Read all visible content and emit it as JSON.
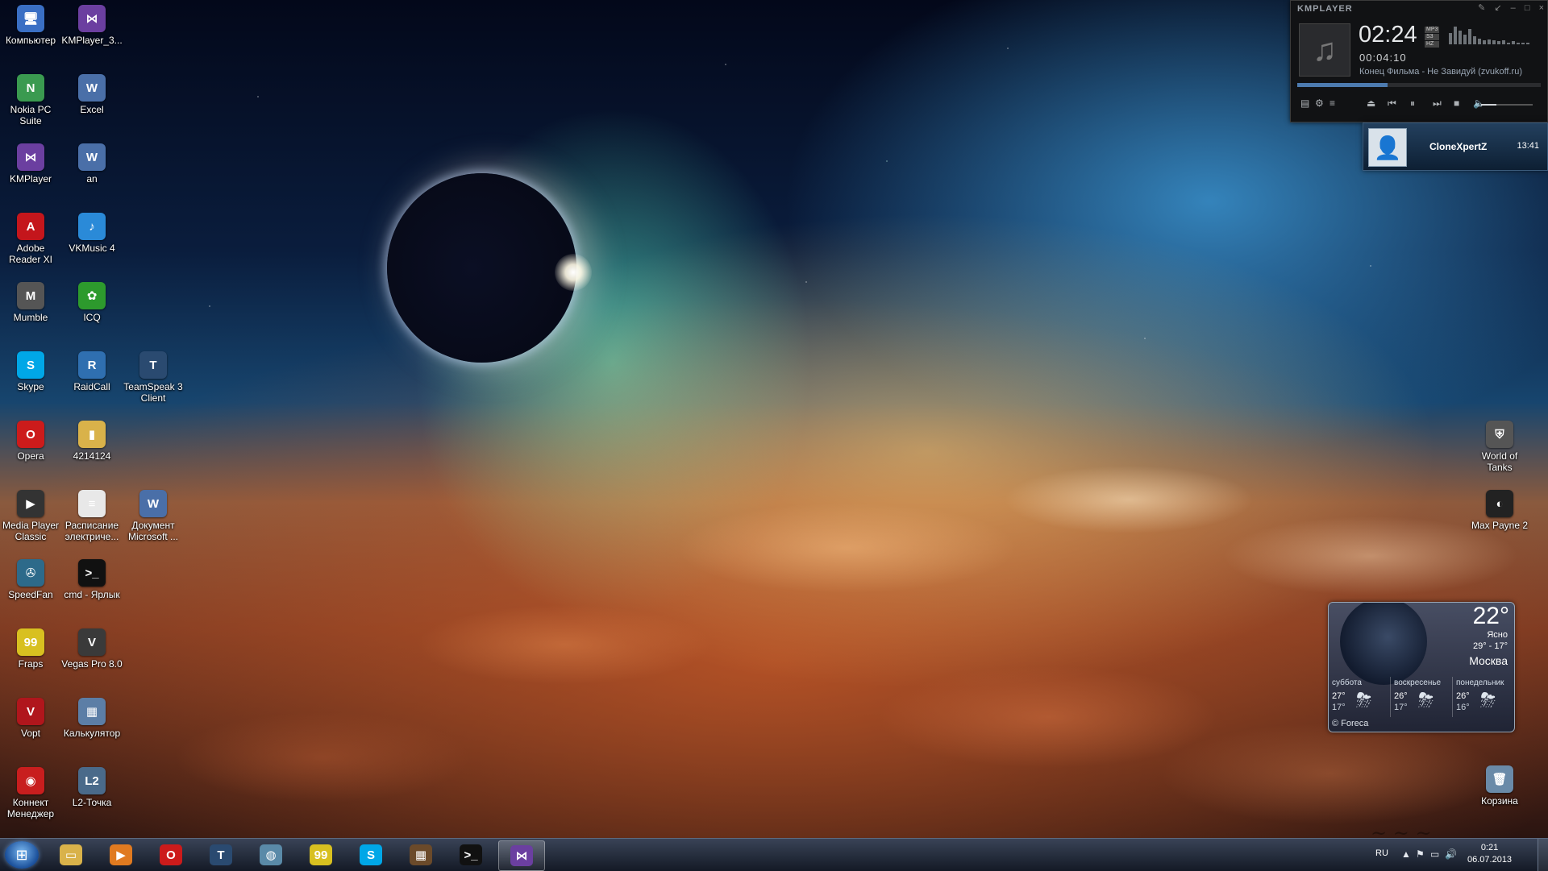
{
  "desktop": {
    "icons_left": [
      {
        "label": "Компьютер",
        "icon": "computer-icon",
        "glyph": "🖥",
        "color": "#3a6fc4"
      },
      {
        "label": "KMPlayer_3...",
        "icon": "kmplayer-icon",
        "glyph": "⋈",
        "color": "#6b3fa0"
      },
      {
        "label": "Nokia PC Suite",
        "icon": "nokia-icon",
        "glyph": "N",
        "color": "#3a9a50"
      },
      {
        "label": "Excel",
        "icon": "document-icon",
        "glyph": "W",
        "color": "#4a6fa8"
      },
      {
        "label": "KMPlayer",
        "icon": "kmplayer-icon",
        "glyph": "⋈",
        "color": "#6b3fa0"
      },
      {
        "label": "an",
        "icon": "document-icon",
        "glyph": "W",
        "color": "#4a6fa8"
      },
      {
        "label": "Adobe Reader XI",
        "icon": "adobe-reader-icon",
        "glyph": "A",
        "color": "#c4161c"
      },
      {
        "label": "VKMusic 4",
        "icon": "vkmusic-icon",
        "glyph": "♪",
        "color": "#2a8ad8"
      },
      {
        "label": "Mumble",
        "icon": "mumble-icon",
        "glyph": "M",
        "color": "#555"
      },
      {
        "label": "ICQ",
        "icon": "icq-icon",
        "glyph": "✿",
        "color": "#2d9a2d"
      },
      {
        "label": "Skype",
        "icon": "skype-icon",
        "glyph": "S",
        "color": "#00a7e7"
      },
      {
        "label": "RaidCall",
        "icon": "raidcall-icon",
        "glyph": "R",
        "color": "#2f6fb0"
      },
      {
        "label": "TeamSpeak 3 Client",
        "icon": "teamspeak-icon",
        "glyph": "T",
        "color": "#2a4a70"
      },
      {
        "label": "Opera",
        "icon": "opera-icon",
        "glyph": "O",
        "color": "#cc1b1b"
      },
      {
        "label": "4214124",
        "icon": "folder-icon",
        "glyph": "▮",
        "color": "#d9b24a"
      },
      {
        "label": "Media Player Classic",
        "icon": "mpc-icon",
        "glyph": "▶",
        "color": "#333"
      },
      {
        "label": "Расписание электриче...",
        "icon": "text-file-icon",
        "glyph": "≡",
        "color": "#e8e8e8"
      },
      {
        "label": "Документ Microsoft ...",
        "icon": "document-icon",
        "glyph": "W",
        "color": "#4a6fa8"
      },
      {
        "label": "SpeedFan",
        "icon": "speedfan-icon",
        "glyph": "✇",
        "color": "#2d6a8a"
      },
      {
        "label": "cmd - Ярлык",
        "icon": "cmd-icon",
        "glyph": ">_",
        "color": "#111"
      },
      {
        "label": "Fraps",
        "icon": "fraps-icon",
        "glyph": "99",
        "color": "#d8c020"
      },
      {
        "label": "Vegas Pro 8.0",
        "icon": "vegas-icon",
        "glyph": "V",
        "color": "#3a3a3a"
      },
      {
        "label": "Vopt",
        "icon": "vopt-icon",
        "glyph": "V",
        "color": "#b0161c"
      },
      {
        "label": "Калькулятор",
        "icon": "calculator-icon",
        "glyph": "▦",
        "color": "#5c7ea6"
      },
      {
        "label": "Коннект Менеджер",
        "icon": "connect-manager-icon",
        "glyph": "◉",
        "color": "#c81e1e"
      },
      {
        "label": "L2-Точка",
        "icon": "l2-icon",
        "glyph": "L2",
        "color": "#4a6a8a"
      }
    ],
    "icons_right": [
      {
        "label": "World of Tanks",
        "icon": "world-of-tanks-icon",
        "glyph": "⛨",
        "color": "#555"
      },
      {
        "label": "Max Payne 2",
        "icon": "max-payne-icon",
        "glyph": "◐",
        "color": "#222"
      },
      {
        "label": "Корзина",
        "icon": "recycle-bin-icon",
        "glyph": "🗑",
        "color": "#6a8aa8"
      }
    ]
  },
  "kmplayer": {
    "brand": "KMPLAYER",
    "time": "02:24",
    "elapsed": "00:04:10",
    "track": "Конец Фильма - Не Завидуй (zvukoff.ru)",
    "progress": 0.37,
    "volume": 0.3,
    "badges": [
      "MP3",
      "S3",
      "HZ"
    ],
    "eq_levels": [
      0.6,
      0.9,
      0.7,
      0.5,
      0.8,
      0.4,
      0.3,
      0.2,
      0.25,
      0.2,
      0.15,
      0.2,
      0.1,
      0.15,
      0.1,
      0.1,
      0.08
    ]
  },
  "notification": {
    "name": "CloneXpertZ",
    "time": "13:41"
  },
  "weather": {
    "temp": "22°",
    "condition": "Ясно",
    "range": "29° - 17°",
    "city": "Москва",
    "days": [
      {
        "name": "суббота",
        "hi": "27°",
        "lo": "17°"
      },
      {
        "name": "воскресенье",
        "hi": "26°",
        "lo": "17°"
      },
      {
        "name": "понедельник",
        "hi": "26°",
        "lo": "16°"
      }
    ],
    "source": "© Foreca"
  },
  "taskbar": {
    "items": [
      {
        "icon": "explorer-folder-icon",
        "glyph": "▭",
        "color": "#d9b24a"
      },
      {
        "icon": "media-player-icon",
        "glyph": "▶",
        "color": "#e07a20"
      },
      {
        "icon": "opera-icon",
        "glyph": "O",
        "color": "#cc1b1b"
      },
      {
        "icon": "teamspeak-icon",
        "glyph": "T",
        "color": "#2a4a70"
      },
      {
        "icon": "globe-icon",
        "glyph": "◍",
        "color": "#5a8aa8"
      },
      {
        "icon": "fraps-icon",
        "glyph": "99",
        "color": "#d8c020"
      },
      {
        "icon": "skype-icon",
        "glyph": "S",
        "color": "#00a7e7"
      },
      {
        "icon": "game-icon",
        "glyph": "▦",
        "color": "#6b4a2a"
      },
      {
        "icon": "cmd-icon",
        "glyph": ">_",
        "color": "#111"
      },
      {
        "icon": "kmplayer-icon",
        "glyph": "⋈",
        "color": "#6b3fa0"
      }
    ],
    "language": "RU",
    "clock_time": "0:21",
    "clock_date": "06.07.2013"
  }
}
